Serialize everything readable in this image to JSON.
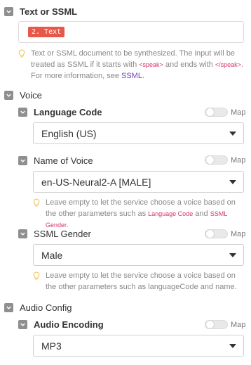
{
  "text_or_ssml": {
    "label": "Text or SSML",
    "pill": "2. Text",
    "help_pre": "Text or SSML document to be synthesized. The input will be treated as SSML if it starts with",
    "help_speak_open": "<speak>",
    "help_mid": "and ends with",
    "help_speak_close": "</speak>",
    "help_post": ". For more information, see",
    "help_link": "SSML",
    "help_end": "."
  },
  "voice": {
    "label": "Voice",
    "language_code": {
      "label": "Language Code",
      "map_label": "Map",
      "value": "English (US)"
    },
    "name_of_voice": {
      "label": "Name of Voice",
      "map_label": "Map",
      "value": "en-US-Neural2-A [MALE]",
      "help_pre": "Leave empty to let the service choose a voice based on the other parameters such as",
      "help_link1": "Language Code",
      "help_and": "and",
      "help_link2": "SSML Gender",
      "help_end": "."
    },
    "ssml_gender": {
      "label": "SSML Gender",
      "map_label": "Map",
      "value": "Male",
      "help": "Leave empty to let the service choose a voice based on the other parameters such as languageCode and name."
    }
  },
  "audio_config": {
    "label": "Audio Config",
    "audio_encoding": {
      "label": "Audio Encoding",
      "map_label": "Map",
      "value": "MP3"
    }
  },
  "colors": {
    "pill_bg": "#e8584a",
    "checkbox": "#8f8f8f",
    "code_text": "#d6336c",
    "link": "#6f42c1"
  }
}
